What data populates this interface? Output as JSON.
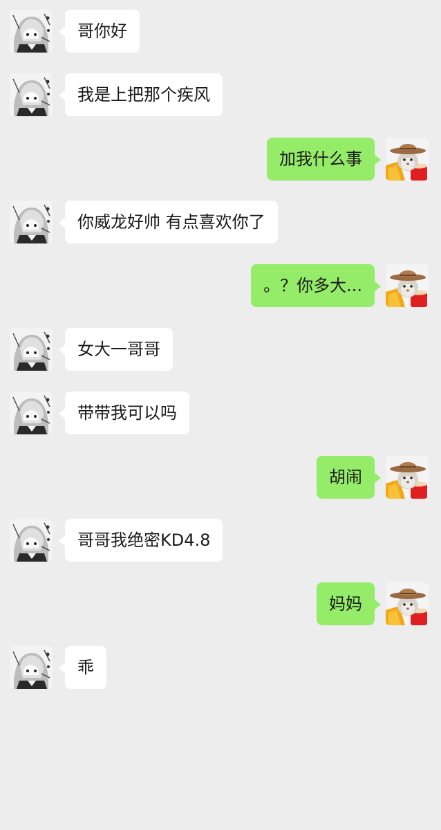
{
  "colors": {
    "background": "#ededed",
    "incoming_bubble": "#ffffff",
    "outgoing_bubble": "#95ec69",
    "text": "#1a1a1a"
  },
  "avatars": {
    "left": "anime-girl-avatar-icon",
    "right": "cowboy-hat-cat-avatar-icon"
  },
  "messages": [
    {
      "side": "left",
      "text": "哥你好"
    },
    {
      "side": "left",
      "text": "我是上把那个疾风"
    },
    {
      "side": "right",
      "text": "加我什么事"
    },
    {
      "side": "left",
      "text": "你威龙好帅 有点喜欢你了"
    },
    {
      "side": "right",
      "text": "。？你多大..."
    },
    {
      "side": "left",
      "text": "女大一哥哥"
    },
    {
      "side": "left",
      "text": "带带我可以吗"
    },
    {
      "side": "right",
      "text": "胡闹"
    },
    {
      "side": "left",
      "text": "哥哥我绝密KD4.8"
    },
    {
      "side": "right",
      "text": "妈妈"
    },
    {
      "side": "left",
      "text": "乖"
    }
  ]
}
